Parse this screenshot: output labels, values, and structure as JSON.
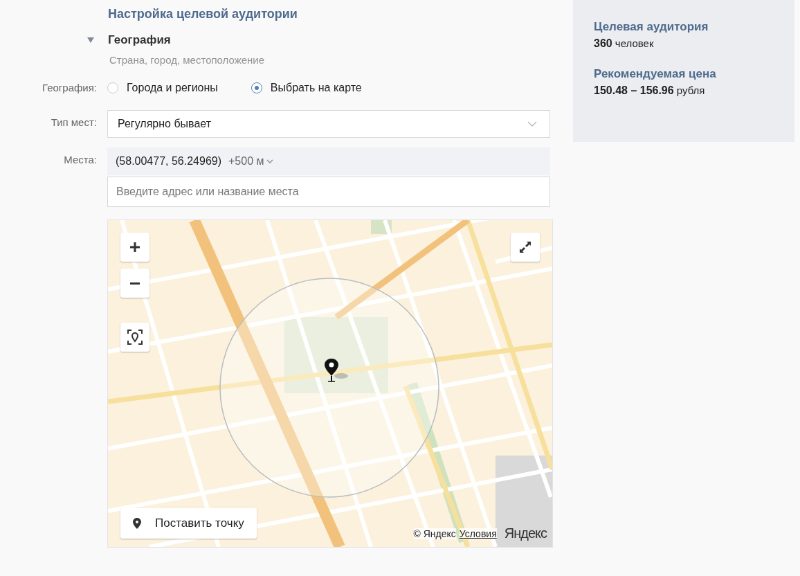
{
  "heading": "Настройка целевой аудитории",
  "section": {
    "title": "География",
    "expanded": true,
    "subtitle": "Страна, город, местоположение"
  },
  "geography": {
    "label": "География:",
    "options": [
      {
        "label": "Города и регионы",
        "selected": false
      },
      {
        "label": "Выбрать на карте",
        "selected": true
      }
    ]
  },
  "place_type": {
    "label": "Тип мест:",
    "value": "Регулярно бывает"
  },
  "places": {
    "label": "Места:",
    "coordinates": "(58.00477, 56.24969)",
    "radius": "+500 м",
    "search": {
      "placeholder": "Введите адрес или название места"
    }
  },
  "map": {
    "place_button": "Поставить точку",
    "copyright": "© Яндекс",
    "terms_link": "Условия",
    "logo": "Яндекс"
  },
  "summary": [
    {
      "title": "Целевая аудитория",
      "value": "360",
      "unit": "человек"
    },
    {
      "title": "Рекомендуемая цена",
      "value": "150.48 – 156.96",
      "unit": "рубля"
    }
  ]
}
